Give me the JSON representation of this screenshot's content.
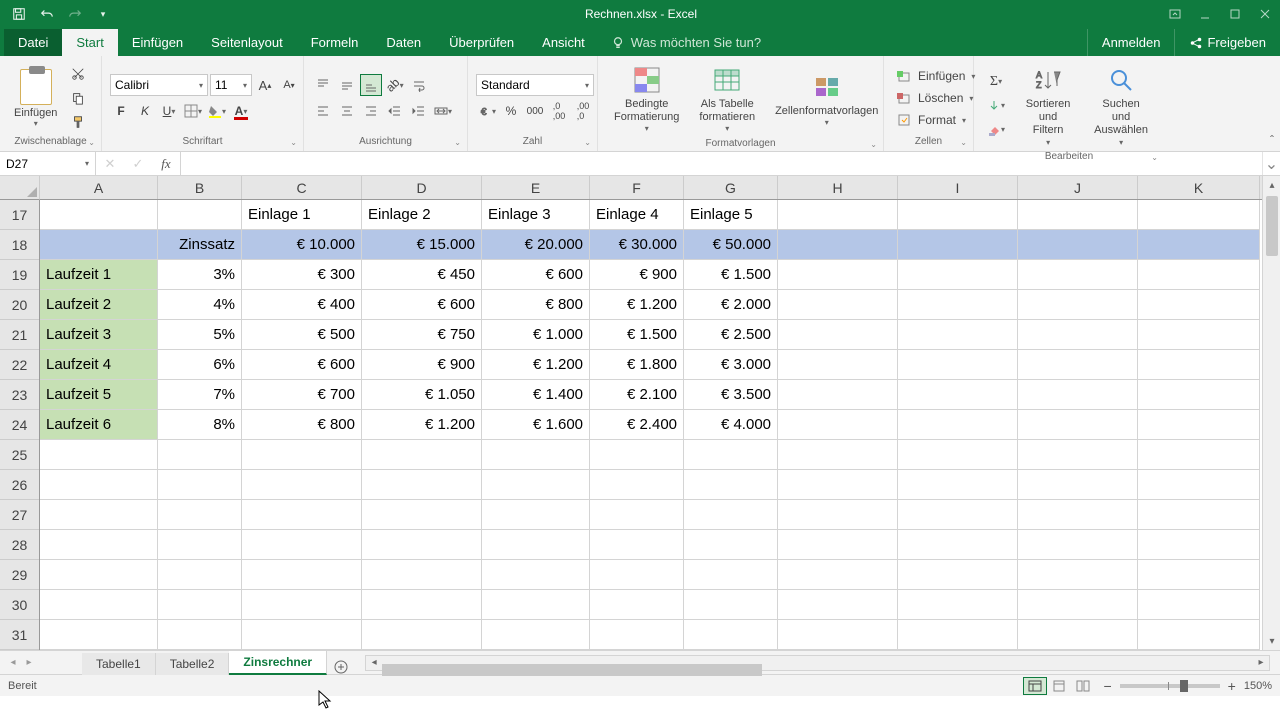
{
  "title": "Rechnen.xlsx - Excel",
  "tabs": {
    "file": "Datei",
    "start": "Start",
    "insert": "Einfügen",
    "layout": "Seitenlayout",
    "formulas": "Formeln",
    "data": "Daten",
    "review": "Überprüfen",
    "view": "Ansicht",
    "search": "Was möchten Sie tun?",
    "signin": "Anmelden",
    "share": "Freigeben"
  },
  "ribbon": {
    "paste": "Einfügen",
    "clipboard": "Zwischenablage",
    "font_name": "Calibri",
    "font_size": "11",
    "font_group": "Schriftart",
    "align_group": "Ausrichtung",
    "number_format": "Standard",
    "number_group": "Zahl",
    "cond_fmt": "Bedingte\nFormatierung",
    "as_table": "Als Tabelle\nformatieren",
    "cell_styles": "Zellenformatvorlagen",
    "styles_group": "Formatvorlagen",
    "ins": "Einfügen",
    "del": "Löschen",
    "fmt": "Format",
    "cells_group": "Zellen",
    "sort": "Sortieren und\nFiltern",
    "find": "Suchen und\nAuswählen",
    "edit_group": "Bearbeiten"
  },
  "namebox": "D27",
  "cols": [
    "A",
    "B",
    "C",
    "D",
    "E",
    "F",
    "G",
    "H",
    "I",
    "J",
    "K"
  ],
  "rows": [
    "17",
    "18",
    "19",
    "20",
    "21",
    "22",
    "23",
    "24",
    "25",
    "26",
    "27",
    "28",
    "29",
    "30",
    "31"
  ],
  "grid": {
    "r17": {
      "C": "Einlage 1",
      "D": "Einlage 2",
      "E": "Einlage 3",
      "F": "Einlage 4",
      "G": "Einlage 5"
    },
    "r18": {
      "B": "Zinssatz",
      "C": "€ 10.000",
      "D": "€ 15.000",
      "E": "€ 20.000",
      "F": "€ 30.000",
      "G": "€ 50.000"
    },
    "r19": {
      "A": "Laufzeit 1",
      "B": "3%",
      "C": "€ 300",
      "D": "€ 450",
      "E": "€ 600",
      "F": "€ 900",
      "G": "€ 1.500"
    },
    "r20": {
      "A": "Laufzeit 2",
      "B": "4%",
      "C": "€ 400",
      "D": "€ 600",
      "E": "€ 800",
      "F": "€ 1.200",
      "G": "€ 2.000"
    },
    "r21": {
      "A": "Laufzeit 3",
      "B": "5%",
      "C": "€ 500",
      "D": "€ 750",
      "E": "€ 1.000",
      "F": "€ 1.500",
      "G": "€ 2.500"
    },
    "r22": {
      "A": "Laufzeit 4",
      "B": "6%",
      "C": "€ 600",
      "D": "€ 900",
      "E": "€ 1.200",
      "F": "€ 1.800",
      "G": "€ 3.000"
    },
    "r23": {
      "A": "Laufzeit 5",
      "B": "7%",
      "C": "€ 700",
      "D": "€ 1.050",
      "E": "€ 1.400",
      "F": "€ 2.100",
      "G": "€ 3.500"
    },
    "r24": {
      "A": "Laufzeit 6",
      "B": "8%",
      "C": "€ 800",
      "D": "€ 1.200",
      "E": "€ 1.600",
      "F": "€ 2.400",
      "G": "€ 4.000"
    }
  },
  "sheets": {
    "t1": "Tabelle1",
    "t2": "Tabelle2",
    "t3": "Zinsrechner"
  },
  "status": "Bereit",
  "zoom": "150%"
}
